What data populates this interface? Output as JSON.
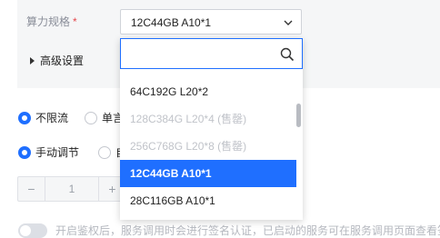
{
  "form": {
    "spec_label": "算力规格",
    "spec_required_mark": "*",
    "spec_selected": "12C44GB A10*1",
    "advanced_label": "高级设置"
  },
  "dropdown": {
    "search_placeholder": "",
    "options": [
      {
        "label": "64C192G L20*2",
        "disabled": false,
        "selected": false
      },
      {
        "label": "128C384G L20*4 (售罄)",
        "disabled": true,
        "selected": false
      },
      {
        "label": "256C768G L20*8 (售罄)",
        "disabled": true,
        "selected": false
      },
      {
        "label": "12C44GB A10*1",
        "disabled": false,
        "selected": true
      },
      {
        "label": "28C116GB A10*1",
        "disabled": false,
        "selected": false
      }
    ]
  },
  "rate_limit": {
    "option_1": "不限流",
    "option_2": "单言"
  },
  "scaling": {
    "option_1": "手动调节",
    "option_2": "自"
  },
  "stepper": {
    "minus": "−",
    "value": "1",
    "plus": "+"
  },
  "auth": {
    "hint": "开启鉴权后，服务调用时会进行签名认证，已启动的服务可在服务调用页面查看签"
  },
  "colors": {
    "accent": "#1f6fff",
    "required": "#e5484d"
  }
}
